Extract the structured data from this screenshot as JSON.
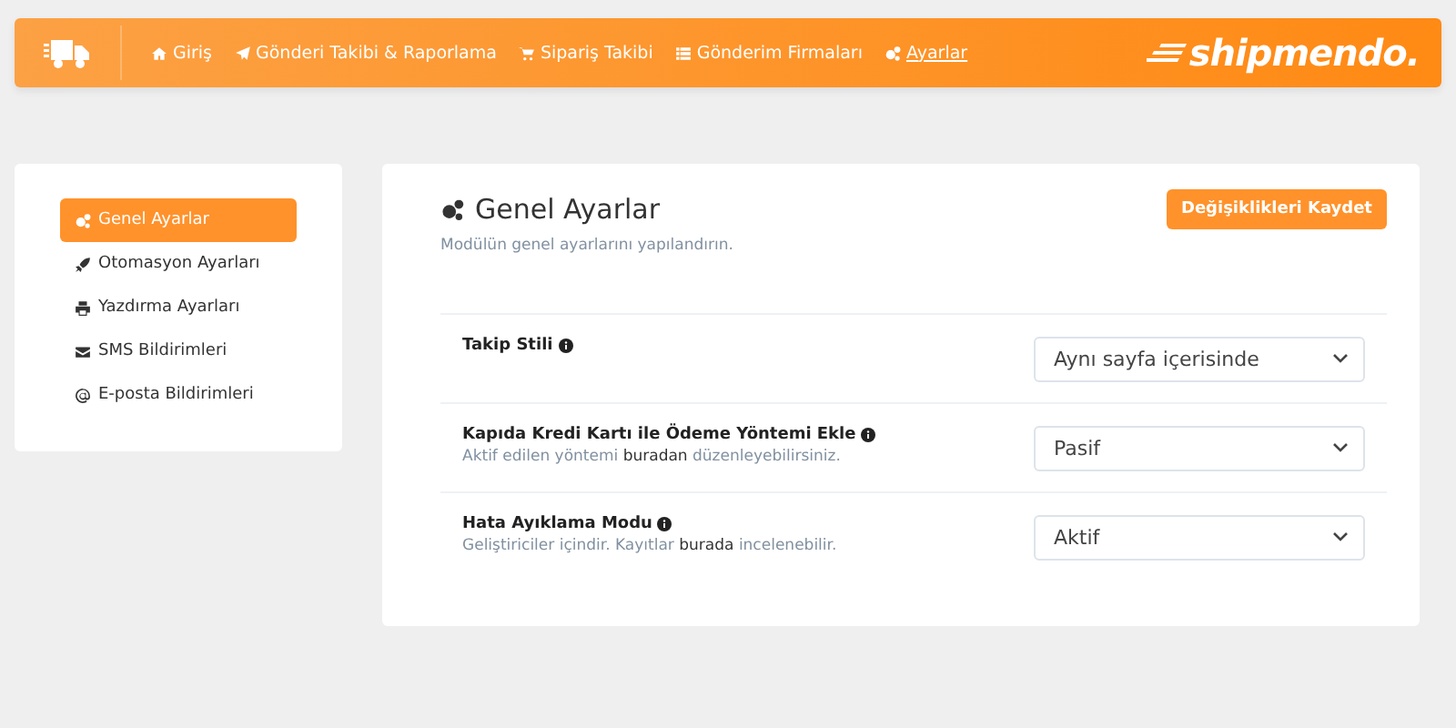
{
  "nav": {
    "items": [
      {
        "label": "Giriş",
        "selected": false
      },
      {
        "label": "Gönderi Takibi & Raporlama",
        "selected": false
      },
      {
        "label": "Sipariş Takibi",
        "selected": false
      },
      {
        "label": "Gönderim Firmaları",
        "selected": false
      },
      {
        "label": "Ayarlar",
        "selected": true
      }
    ],
    "logo": "shipmendo."
  },
  "sidebar": {
    "items": [
      {
        "label": "Genel Ayarlar",
        "selected": true
      },
      {
        "label": "Otomasyon Ayarları",
        "selected": false
      },
      {
        "label": "Yazdırma Ayarları",
        "selected": false
      },
      {
        "label": "SMS Bildirimleri",
        "selected": false
      },
      {
        "label": "E-posta Bildirimleri",
        "selected": false
      }
    ]
  },
  "panel": {
    "title": "Genel Ayarlar",
    "subtitle": "Modülün genel ayarlarını yapılandırın.",
    "save_button": "Değişiklikleri Kaydet",
    "settings": [
      {
        "label": "Takip Stili",
        "value": "Aynı sayfa içerisinde"
      },
      {
        "label": "Kapıda Kredi Kartı ile Ödeme Yöntemi Ekle",
        "description": {
          "before": "Aktif edilen yöntemi",
          "link": "buradan",
          "after": "düzenleyebilirsiniz."
        },
        "value": "Pasif"
      },
      {
        "label": "Hata Ayıklama Modu",
        "description": {
          "before": "Geliştiriciler içindir. Kayıtlar",
          "link": "burada",
          "after": "incelenebilir."
        },
        "value": "Aktif"
      }
    ]
  }
}
